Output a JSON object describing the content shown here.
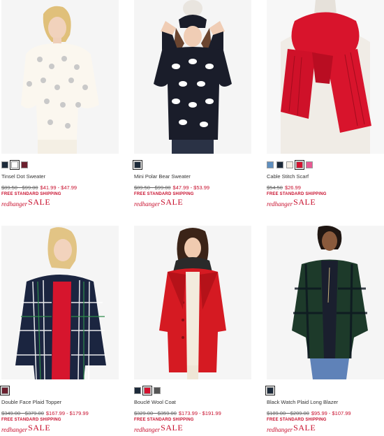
{
  "products": [
    {
      "name": "Tinsel Dot Sweater",
      "orig_price": "$89.50 - $99.00",
      "sale_price": "$41.99 - $47.99",
      "shipping": "FREE STANDARD SHIPPING",
      "swatches": [
        "#1c2a3a",
        "#ffffff",
        "#6b1f2e"
      ],
      "promo_left": "redhanger",
      "promo_right": "SALE",
      "image_alt": "woman in cream sweater with grey dots"
    },
    {
      "name": "Mini Polar Bear Sweater",
      "orig_price": "$89.50 - $99.00",
      "sale_price": "$47.99 - $53.99",
      "shipping": "FREE STANDARD SHIPPING",
      "swatches": [
        "#1c2a3a"
      ],
      "promo_left": "redhanger",
      "promo_right": "SALE",
      "image_alt": "woman in navy sweater with white polar bears"
    },
    {
      "name": "Cable Stitch Scarf",
      "orig_price": "$54.50",
      "sale_price": "$26.99",
      "shipping": "FREE STANDARD SHIPPING",
      "swatches": [
        "#5f8fbf",
        "#1c2a3a",
        "#f4eee4",
        "#d4112e",
        "#e85a93"
      ],
      "promo_left": "redhanger",
      "promo_right": "SALE",
      "image_alt": "red cable knit scarf on mannequin"
    },
    {
      "name": "Double Face Plaid Topper",
      "orig_price": "$349.00 - $379.00",
      "sale_price": "$167.99 - $179.99",
      "shipping": "FREE STANDARD SHIPPING",
      "swatches": [
        "#6b1f2e"
      ],
      "promo_left": "redhanger",
      "promo_right": "SALE",
      "image_alt": "woman in navy plaid coat"
    },
    {
      "name": "Bouclé Wool Coat",
      "orig_price": "$329.00 - $359.00",
      "sale_price": "$173.99 - $191.99",
      "shipping": "FREE STANDARD SHIPPING",
      "swatches": [
        "#1c2a3a",
        "#d4112e",
        "#555555"
      ],
      "promo_left": "redhanger",
      "promo_right": "SALE",
      "image_alt": "woman in red wool coat"
    },
    {
      "name": "Black Watch Plaid Long Blazer",
      "orig_price": "$189.00 - $209.00",
      "sale_price": "$95.99 - $107.99",
      "shipping": "FREE STANDARD SHIPPING",
      "swatches": [
        "#1c2a3a"
      ],
      "promo_left": "redhanger",
      "promo_right": "SALE",
      "image_alt": "woman in black watch plaid blazer"
    }
  ]
}
